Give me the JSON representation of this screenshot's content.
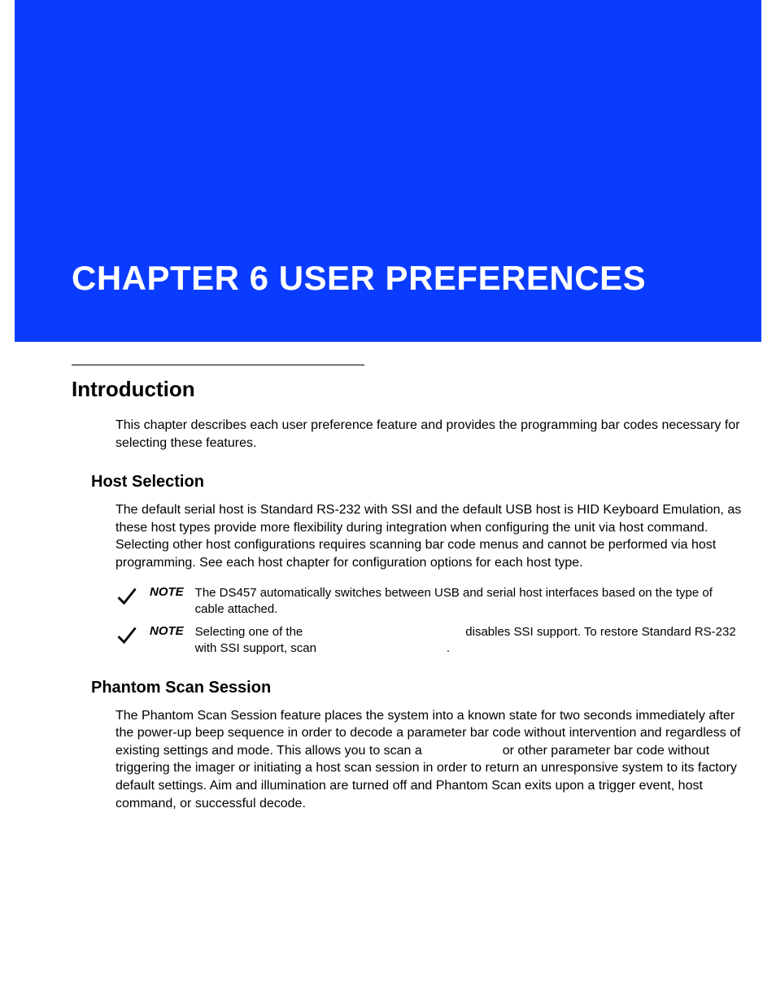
{
  "header": {
    "title": "CHAPTER 6 USER PREFERENCES"
  },
  "sections": {
    "intro": {
      "heading": "Introduction",
      "body": "This chapter describes each user preference feature and provides the programming bar codes necessary for selecting these features."
    },
    "host": {
      "heading": "Host Selection",
      "body": "The default serial host is Standard RS-232 with SSI and the default USB host is HID Keyboard Emulation, as these host types provide more flexibility during integration when configuring the unit via host command. Selecting other host configurations requires scanning bar code menus and cannot be performed via host programming. See each host chapter for configuration options for each host type.",
      "note1_label": "NOTE",
      "note1_text": "The DS457 automatically switches between USB and serial host interfaces based on the type of cable attached.",
      "note2_label": "NOTE",
      "note2_pre": "Selecting one of the",
      "note2_mid": "disables SSI support. To restore Standard RS-232 with SSI support, scan",
      "note2_end": "."
    },
    "phantom": {
      "heading": "Phantom Scan Session",
      "body_pre": "The Phantom Scan Session feature places the system into a known state for two seconds immediately after the power-up beep sequence in order to decode a parameter bar code without intervention and regardless of existing settings and mode. This allows you to scan a",
      "body_post": "or other parameter bar code without triggering the imager or initiating a host scan session in order to return an unresponsive system to its factory default settings. Aim and illumination are turned off and Phantom Scan exits upon a trigger event, host command, or successful decode."
    }
  }
}
